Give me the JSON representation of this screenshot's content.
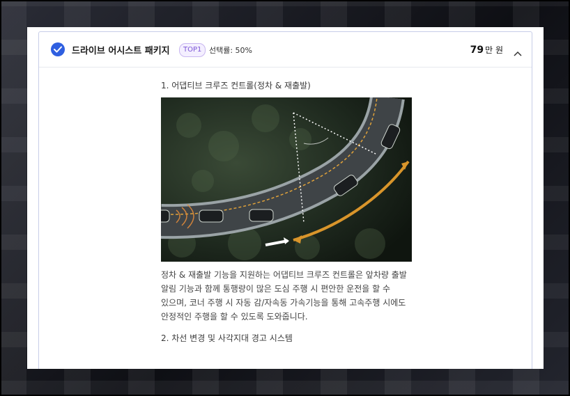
{
  "option": {
    "title": "드라이브 어시스트 패키지",
    "badge": "TOP1",
    "selection_rate": "선택률: 50%",
    "price_number": "79",
    "price_unit": "만 원",
    "selected": true,
    "expanded": true
  },
  "features": [
    {
      "title": "1. 어댑티브 크루즈 컨트롤(정차 & 재출발)",
      "image_alt": "curved-road-cars-aerial",
      "description": "정차 & 재출발 기능을 지원하는 어댑티브 크루즈 컨트롤은 앞차량 출발 알림 기능과 함께 통행량이 많은 도심 주행 시 편안한 운전을 할 수 있으며, 코너 주행 시 자동 감/자속동 가속기능을 통해 고속주행 시에도 안정적인 주행을 할 수 있도록 도와줍니다."
    },
    {
      "title": "2. 차선 변경 및 사각지대 경고 시스템"
    }
  ],
  "colors": {
    "accent": "#2f5fe0",
    "badge_text": "#7b55d6",
    "badge_border": "#c8b6f0",
    "card_border": "#c7cde8"
  },
  "icons": {
    "check": "check-circle-icon",
    "collapse": "chevron-up-icon"
  }
}
